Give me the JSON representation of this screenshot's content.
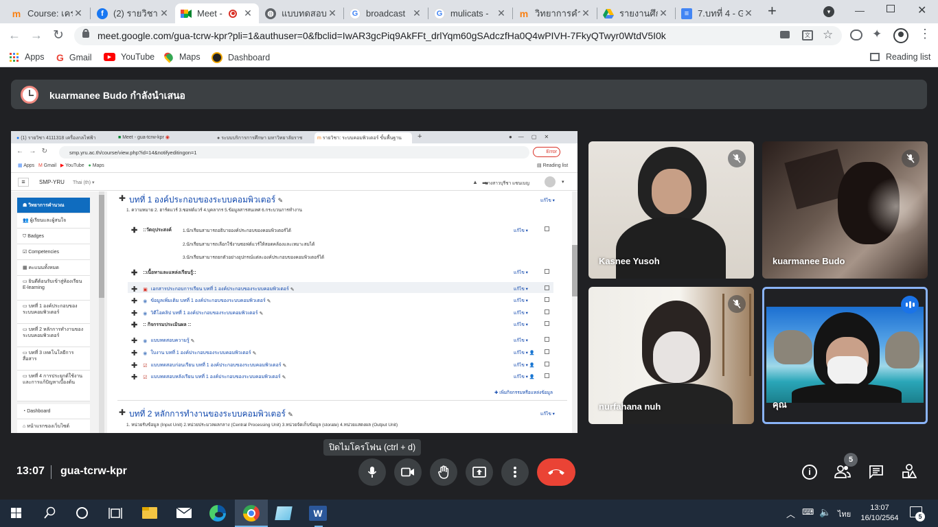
{
  "browser": {
    "tabs": [
      {
        "title": "Course: เคร",
        "favicon_color": "#f98012",
        "favicon": "m"
      },
      {
        "title": "(2) รายวิชา",
        "favicon_color": "#1877f2",
        "favicon": "f"
      },
      {
        "title": "Meet -",
        "favicon_color": "#00832d",
        "favicon": "meet",
        "active": true
      },
      {
        "title": "แบบทดสอบ",
        "favicon_color": "#5f6368",
        "favicon": "globe"
      },
      {
        "title": "broadcast",
        "favicon_color": "#4285f4",
        "favicon": "G"
      },
      {
        "title": "mulicats -",
        "favicon_color": "#4285f4",
        "favicon": "G"
      },
      {
        "title": "วิทยาการคำน",
        "favicon_color": "#f98012",
        "favicon": "m"
      },
      {
        "title": "รายงานศึกษ",
        "favicon_color": "#0f9d58",
        "favicon": "drive"
      },
      {
        "title": "7.บทที่ 4 - G",
        "favicon_color": "#4285f4",
        "favicon": "doc"
      }
    ],
    "url": "meet.google.com/gua-tcrw-kpr?pli=1&authuser=0&fbclid=IwAR3gcPiq9AkFFt_drlYqm60gSAdczfHa0Q4wPIVH-7FkyQTwyr0WtdV5I0k",
    "bookmarks": [
      "Apps",
      "Gmail",
      "YouTube",
      "Maps",
      "Dashboard"
    ],
    "reading_list": "Reading list"
  },
  "meet": {
    "presenter_banner": "kuarmanee Budo กำลังนำเสนอ",
    "participants": [
      {
        "name": "Kasnee Yusoh",
        "muted": true
      },
      {
        "name": "kuarmanee Budo",
        "muted": true
      },
      {
        "name": "nurfahana nuh",
        "muted": true
      },
      {
        "name": "คุณ",
        "speaking": true
      }
    ],
    "tooltip": "ปิดไมโครโฟน (ctrl + d)",
    "time": "13:07",
    "meeting_code": "gua-tcrw-kpr",
    "people_count": "5"
  },
  "shared_screen": {
    "tabs": [
      "(1) รายวิชา 4111318 เครื่องกลไฟฟ้า",
      "Meet - gua-tcrw-kpr",
      "ระบบบริการการศึกษา มหาวิทยาลัยราช",
      "รายวิชา: ระบบคอมพิวเตอร์ ขั้นพื้นฐาน"
    ],
    "url": "smp.yru.ac.th/course/view.php?id=14&notifyeditingon=1",
    "error_label": "Error",
    "bookmarks": [
      "Apps",
      "Gmail",
      "YouTube",
      "Maps"
    ],
    "reading_list": "Reading list",
    "site_name": "SMP-YRU",
    "language": "Thai (th)",
    "user_name": "นางสาวบุรีชา แซนเบญ",
    "sidebar": [
      "วิทยาการคำนวณ",
      "ผู้เรียนและผู้สนใจ",
      "Badges",
      "Competencies",
      "คะแนนทั้งหมด",
      "ยินดีต้อนรับเข้าสู่ห้องเรียน E-learning",
      "บทที่ 1 องค์ประกอบของระบบคอมพิวเตอร์",
      "บทที่ 2 หลักการทำงานของระบบคอมพิวเตอร์",
      "บทที่ 3 เทคโนโลยีการสื่อสาร",
      "บทที่ 4 การประยุกต์ใช้งานและการแก้ปัญหาเบื้องต้น",
      "Dashboard",
      "หน้าแรกของเว็บไซต์"
    ],
    "section1_title": "บทที่ 1 องค์ประกอบของระบบคอมพิวเตอร์",
    "section1_summary": "1. ความหมาย 2. ฮาร์ดแวร์ 3.ซอฟต์แวร์ 4.บุคลากร 5.ข้อมูลสารสนเทศ 6.กระบวนการทำงาน",
    "objectives_label": "::วัตถุประสงค์",
    "objectives": [
      "1.นักเรียนสามารถอธิบายองค์ประกอบของคอมพิวเตอร์ได้",
      "2.นักเรียนสามารถเลือกใช้งานซอฟต์แวร์ให้สอดคล้องและเหมาะสมได้",
      "3.นักเรียนสามารถยกตัวอย่างอุปกรณ์แต่ละองค์ประกอบของคอมพิวเตอร์ได้"
    ],
    "content_label": "::เนื้อหาและแหล่งเรียนรู้::",
    "resources": [
      "เอกสารประกอบการเรียน บทที่ 1 องค์ประกอบของระบบคอมพิวเตอร์",
      "ข้อมูลเพิ่มเติม บทที่ 1 องค์ประกอบของระบบคอมพิวเตอร์",
      "วิดีโอคลิป บทที่ 1 องค์ประกอบของระบบคอมพิวเตอร์"
    ],
    "assessment_label": ":: กิจกรรมประเมินผล ::",
    "assessments": [
      "แบบทดสอบความรู้",
      "ใบงาน บทที่ 1 องค์ประกอบของระบบคอมพิวเตอร์",
      "แบบทดสอบก่อนเรียน บทที่ 1 องค์ประกอบของระบบคอมพิวเตอร์",
      "แบบทดสอบหลังเรียน บทที่ 1 องค์ประกอบของระบบคอมพิวเตอร์"
    ],
    "edit_label": "แก้ไข",
    "add_activity": "เพิ่มกิจกรรมหรือแหล่งข้อมูล",
    "section2_title": "บทที่ 2 หลักการทำงานของระบบคอมพิวเตอร์",
    "section2_summary": "1. หน่วยรับข้อมูล (Input Unit) 2.หน่วยประมวลผลกลาง (Central Processing Unit) 3.หน่วยจัดเก็บข้อมูล (storate) 4.หน่วยแสดงผล (Output Unit)"
  },
  "taskbar": {
    "time": "13:07",
    "date": "16/10/2564",
    "language": "ไทย",
    "notification_count": "5"
  }
}
